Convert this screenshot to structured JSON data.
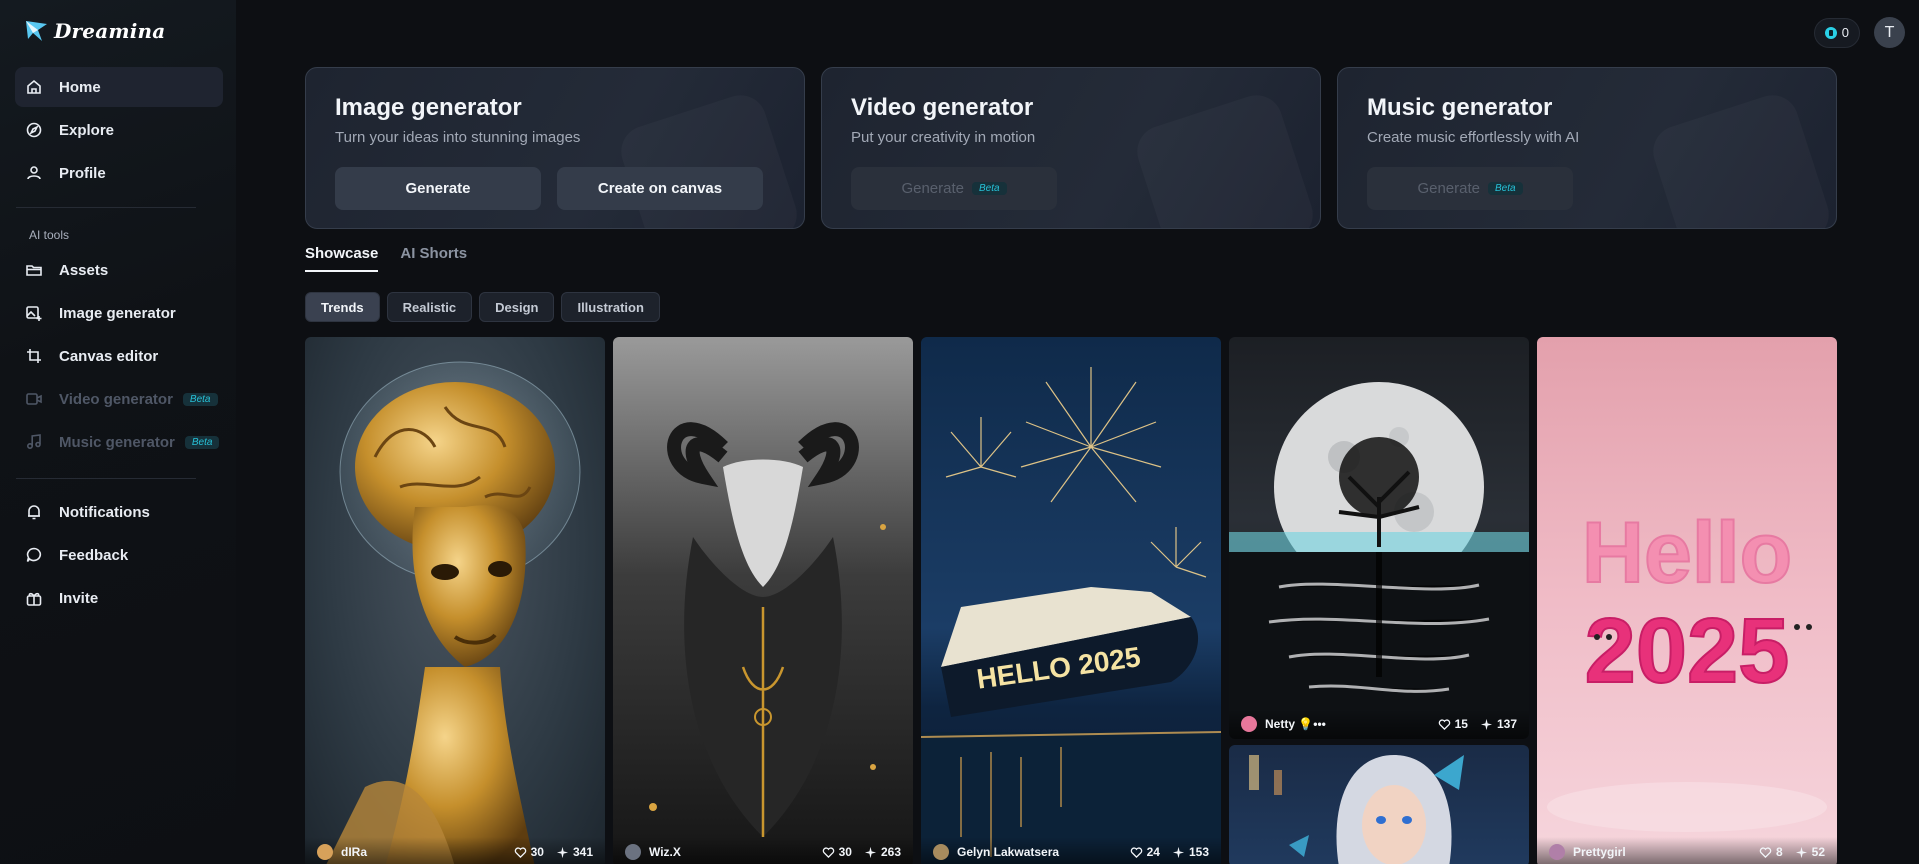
{
  "brand": {
    "name": "Dreamina"
  },
  "sidebar": {
    "items": [
      {
        "label": "Home",
        "icon": "home-icon"
      },
      {
        "label": "Explore",
        "icon": "compass-icon"
      },
      {
        "label": "Profile",
        "icon": "user-icon"
      }
    ],
    "ai_tools_label": "AI tools",
    "tools": [
      {
        "label": "Assets",
        "icon": "folder-icon"
      },
      {
        "label": "Image generator",
        "icon": "image-plus-icon"
      },
      {
        "label": "Canvas editor",
        "icon": "crop-icon"
      },
      {
        "label": "Video generator",
        "icon": "video-icon",
        "badge": "Beta"
      },
      {
        "label": "Music generator",
        "icon": "music-icon",
        "badge": "Beta"
      }
    ],
    "bottom": [
      {
        "label": "Notifications",
        "icon": "bell-icon"
      },
      {
        "label": "Feedback",
        "icon": "chat-icon"
      },
      {
        "label": "Invite",
        "icon": "gift-icon"
      }
    ]
  },
  "header": {
    "credits": "0",
    "avatar_initial": "T"
  },
  "cards": [
    {
      "title": "Image generator",
      "subtitle": "Turn your ideas into stunning images",
      "btn1": "Generate",
      "btn2": "Create on canvas"
    },
    {
      "title": "Video generator",
      "subtitle": "Put your creativity in motion",
      "btn1": "Generate",
      "badge": "Beta"
    },
    {
      "title": "Music generator",
      "subtitle": "Create music effortlessly with AI",
      "btn1": "Generate",
      "badge": "Beta"
    }
  ],
  "tabs": [
    "Showcase",
    "AI Shorts"
  ],
  "chips": [
    "Trends",
    "Realistic",
    "Design",
    "Illustration"
  ],
  "gallery": [
    {
      "user": "dIRa",
      "likes": "30",
      "remixes": "341"
    },
    {
      "user": "Wiz.X",
      "likes": "30",
      "remixes": "263"
    },
    {
      "user": "Gelyn Lakwatsera",
      "likes": "24",
      "remixes": "153"
    },
    {
      "user": "Netty 💡•••",
      "likes": "15",
      "remixes": "137"
    },
    {
      "user": "Prettygirl",
      "likes": "8",
      "remixes": "52"
    }
  ],
  "art_text": {
    "ship": "HELLO 2025",
    "pink_line1": "Hello",
    "pink_line2": "2025"
  },
  "colors": {
    "accent": "#27c0d6",
    "background": "#0d0f13",
    "card": "#242b38"
  }
}
